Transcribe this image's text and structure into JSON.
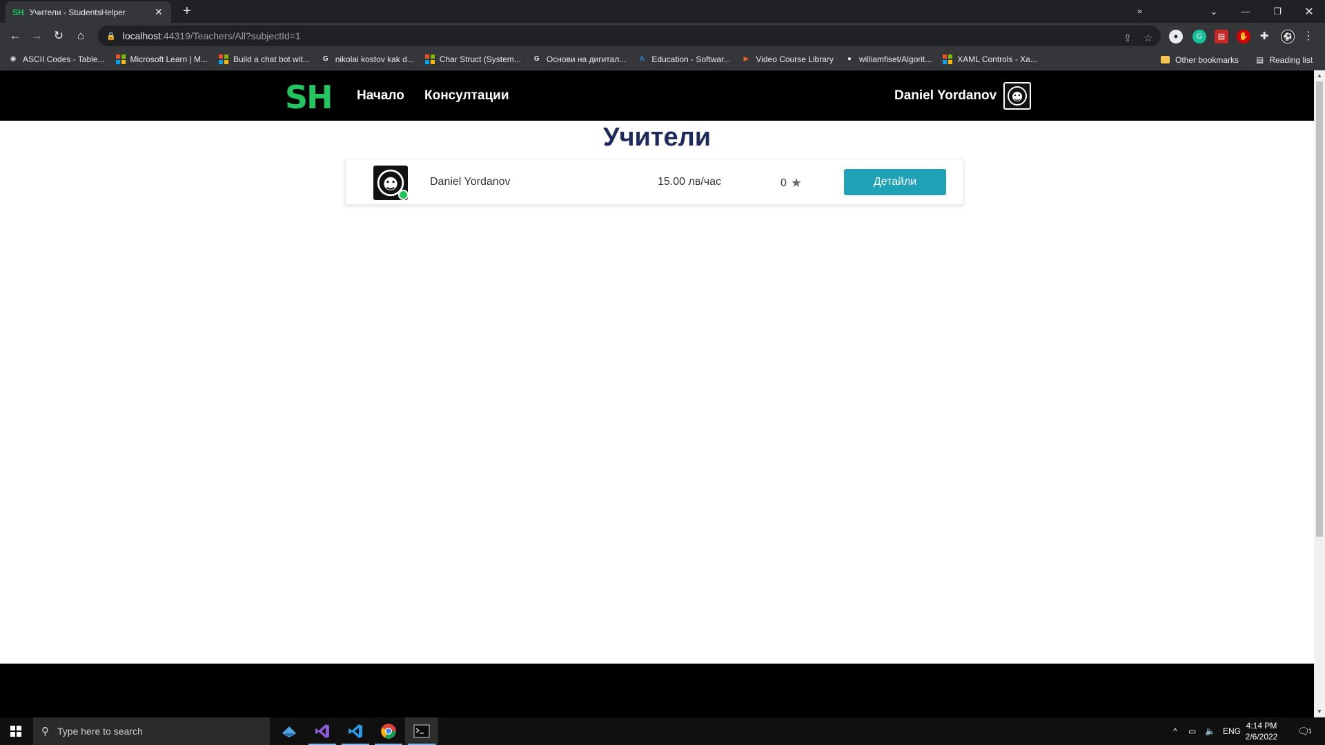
{
  "browser": {
    "tab": {
      "favicon": "SH",
      "title": "Учители - StudentsHelper"
    },
    "url_host": "localhost",
    "url_path": ":44319/Teachers/All?subjectId=1",
    "bookmarks": [
      {
        "label": "ASCII Codes - Table...",
        "icon": "globe-icon",
        "color": "#e8eaed"
      },
      {
        "label": "Microsoft Learn | M...",
        "icon": "microsoft-icon",
        "color": "#f25022"
      },
      {
        "label": "Build a chat bot wit...",
        "icon": "microsoft-icon",
        "color": "#f25022"
      },
      {
        "label": "nikolai kostov kak d...",
        "icon": "google-icon",
        "color": "#e8eaed"
      },
      {
        "label": "Char Struct (System...",
        "icon": "microsoft-icon",
        "color": "#f25022"
      },
      {
        "label": "Основи на дигитал...",
        "icon": "google-icon",
        "color": "#e8eaed"
      },
      {
        "label": "Education - Softwar...",
        "icon": "azure-icon",
        "color": "#1e88e5"
      },
      {
        "label": "Video Course Library",
        "icon": "play-icon",
        "color": "#e8622c"
      },
      {
        "label": "williamfiset/Algorit...",
        "icon": "github-icon",
        "color": "#e8eaed"
      },
      {
        "label": "XAML Controls - Xa...",
        "icon": "microsoft-icon",
        "color": "#f25022"
      }
    ],
    "other_bookmarks": "Other bookmarks",
    "reading_list": "Reading list",
    "overflow": "»"
  },
  "site": {
    "logo": "SH",
    "nav": {
      "home": "Начало",
      "consultations": "Консултации"
    },
    "user_name": "Daniel Yordanov"
  },
  "page": {
    "title": "Учители",
    "teachers": [
      {
        "name": "Daniel Yordanov",
        "price": "15.00 лв/час",
        "rating": "0",
        "details_label": "Детайли",
        "online": true
      }
    ]
  },
  "colors": {
    "logo": "#22c55e",
    "title": "#1f2a5c",
    "button": "#1fa2b8",
    "online": "#22c55e"
  },
  "taskbar": {
    "search_placeholder": "Type here to search",
    "apps": [
      "file-explorer-icon",
      "visual-studio-icon",
      "vscode-icon",
      "chrome-icon",
      "terminal-icon"
    ],
    "language": "ENG",
    "time": "4:14 PM",
    "date": "2/6/2022",
    "notifications": "1"
  }
}
